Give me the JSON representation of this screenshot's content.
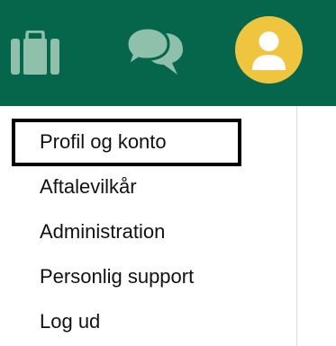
{
  "colors": {
    "header_bg": "#05664b",
    "icon_muted": "#8ec0ab",
    "avatar_bg": "#efc53f",
    "text": "#111111"
  },
  "header": {
    "icons": [
      "briefcase-icon",
      "chat-bubbles-icon",
      "user-avatar-icon"
    ]
  },
  "menu": {
    "items": [
      {
        "label": "Profil og konto",
        "focused": true
      },
      {
        "label": "Aftalevilkår"
      },
      {
        "label": "Administration"
      },
      {
        "label": "Personlig support"
      },
      {
        "label": "Log ud"
      }
    ]
  }
}
